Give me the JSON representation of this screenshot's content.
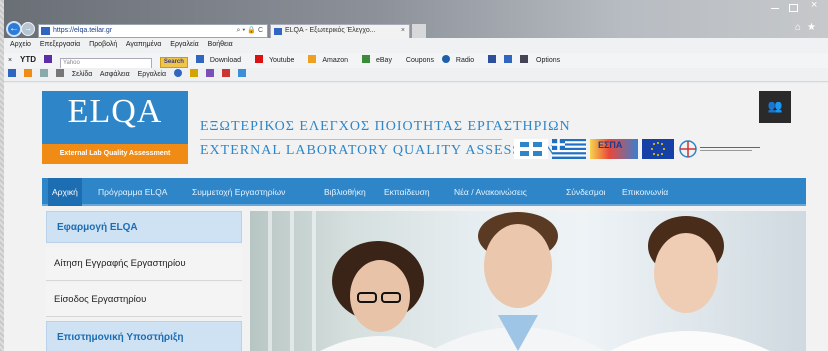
{
  "browser": {
    "url": "https://elqa.teilar.gr",
    "tab_title": "ELQA - Εξωτερικός Έλεγχο...",
    "menu": [
      "Αρχείο",
      "Επεξεργασία",
      "Προβολή",
      "Αγαπημένα",
      "Εργαλεία",
      "Βοήθεια"
    ],
    "links_bar": {
      "ytd": "YTD",
      "search_placeholder": "Yahoo",
      "search_button": "Search",
      "items": [
        "Download",
        "Youtube",
        "Amazon",
        "eBay",
        "Coupons",
        "Radio",
        "Options"
      ]
    },
    "command_bar": [
      "Σελίδα",
      "Ασφάλεια",
      "Εργαλεία"
    ]
  },
  "site": {
    "logo": "ELQA",
    "logo_sub": "External Lab Quality Assessment",
    "header_greek": "ΕΞΩΤΕΡΙΚΟΣ ΕΛΕΓΧΟΣ ΠΟΙΟΤΗΤΑΣ ΕΡΓΑΣΤΗΡΙΩΝ",
    "header_english": "EXTERNAL LABORATORY QUALITY ASSESSMENT",
    "espa_label": "ΕΣΠΑ",
    "nav": [
      "Αρχική",
      "Πρόγραμμα ELQA",
      "Συμμετοχή Εργαστηρίων",
      "Βιβλιοθήκη",
      "Εκπαίδευση",
      "Νέα / Ανακοινώσεις",
      "Σύνδεσμοι",
      "Επικοινωνία"
    ],
    "sidebar": {
      "head1": "Εφαρμογή ELQA",
      "item1": "Αίτηση Εγγραφής Εργαστηρίου",
      "item2": "Είσοδος Εργαστηρίου",
      "head2": "Επιστημονική Υποστήριξη"
    }
  },
  "colors": {
    "brand_blue": "#2e86c9",
    "brand_orange": "#f08c16"
  }
}
